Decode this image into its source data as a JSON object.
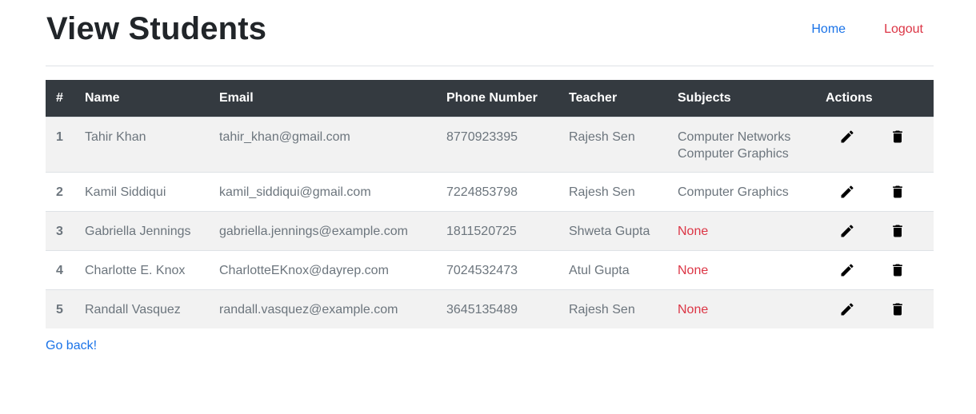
{
  "header": {
    "title": "View Students",
    "nav": {
      "home": "Home",
      "logout": "Logout"
    }
  },
  "table": {
    "columns": [
      "#",
      "Name",
      "Email",
      "Phone Number",
      "Teacher",
      "Subjects",
      "Actions"
    ],
    "rows": [
      {
        "num": "1",
        "name": "Tahir Khan",
        "email": "tahir_khan@gmail.com",
        "phone": "8770923395",
        "teacher": "Rajesh Sen",
        "subjects": [
          "Computer Networks",
          "Computer Graphics"
        ]
      },
      {
        "num": "2",
        "name": "Kamil Siddiqui",
        "email": "kamil_siddiqui@gmail.com",
        "phone": "7224853798",
        "teacher": "Rajesh Sen",
        "subjects": [
          "Computer Graphics"
        ]
      },
      {
        "num": "3",
        "name": "Gabriella Jennings",
        "email": "gabriella.jennings@example.com",
        "phone": "1811520725",
        "teacher": "Shweta Gupta",
        "subjects": [
          "None"
        ]
      },
      {
        "num": "4",
        "name": "Charlotte E. Knox",
        "email": "CharlotteEKnox@dayrep.com",
        "phone": "7024532473",
        "teacher": "Atul Gupta",
        "subjects": [
          "None"
        ]
      },
      {
        "num": "5",
        "name": "Randall Vasquez",
        "email": "randall.vasquez@example.com",
        "phone": "3645135489",
        "teacher": "Rajesh Sen",
        "subjects": [
          "None"
        ]
      }
    ],
    "action_icons": {
      "edit": "pencil-icon",
      "delete": "trash-icon"
    }
  },
  "footer": {
    "back_label": "Go back!"
  },
  "colors": {
    "header_bg": "#343a40",
    "link": "#1a73e8",
    "danger": "#dc3545",
    "stripe": "#f2f2f2"
  }
}
